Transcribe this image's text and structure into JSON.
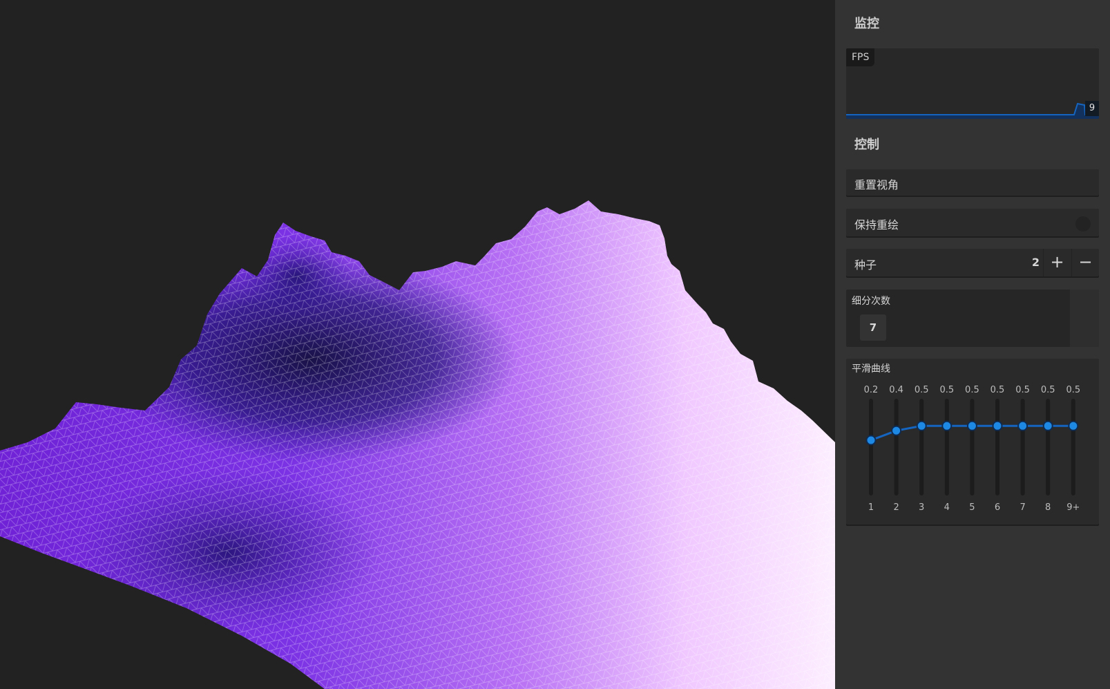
{
  "viewport": {
    "scene": "terrain-wireframe",
    "colors": {
      "low": "#1a1060",
      "mid": "#7a2ee0",
      "high": "#fbe6ff",
      "background": "#222222"
    }
  },
  "panel": {
    "monitor": {
      "title": "监控",
      "fps": {
        "label": "FPS",
        "value": "9",
        "accent": "#1565c0"
      }
    },
    "controls": {
      "title": "控制",
      "reset_view_label": "重置视角",
      "keep_redraw_label": "保持重绘",
      "seed": {
        "label": "种子",
        "value": "2",
        "plus": "+",
        "minus": "−"
      },
      "subdivisions": {
        "label": "细分次数",
        "value": "7"
      },
      "smooth_curve": {
        "label": "平滑曲线",
        "values": [
          0.2,
          0.4,
          0.5,
          0.5,
          0.5,
          0.5,
          0.5,
          0.5,
          0.5
        ],
        "value_labels": [
          "0.2",
          "0.4",
          "0.5",
          "0.5",
          "0.5",
          "0.5",
          "0.5",
          "0.5",
          "0.5"
        ],
        "indices": [
          "1",
          "2",
          "3",
          "4",
          "5",
          "6",
          "7",
          "8",
          "9+"
        ],
        "accent": "#1e88e5"
      }
    }
  }
}
